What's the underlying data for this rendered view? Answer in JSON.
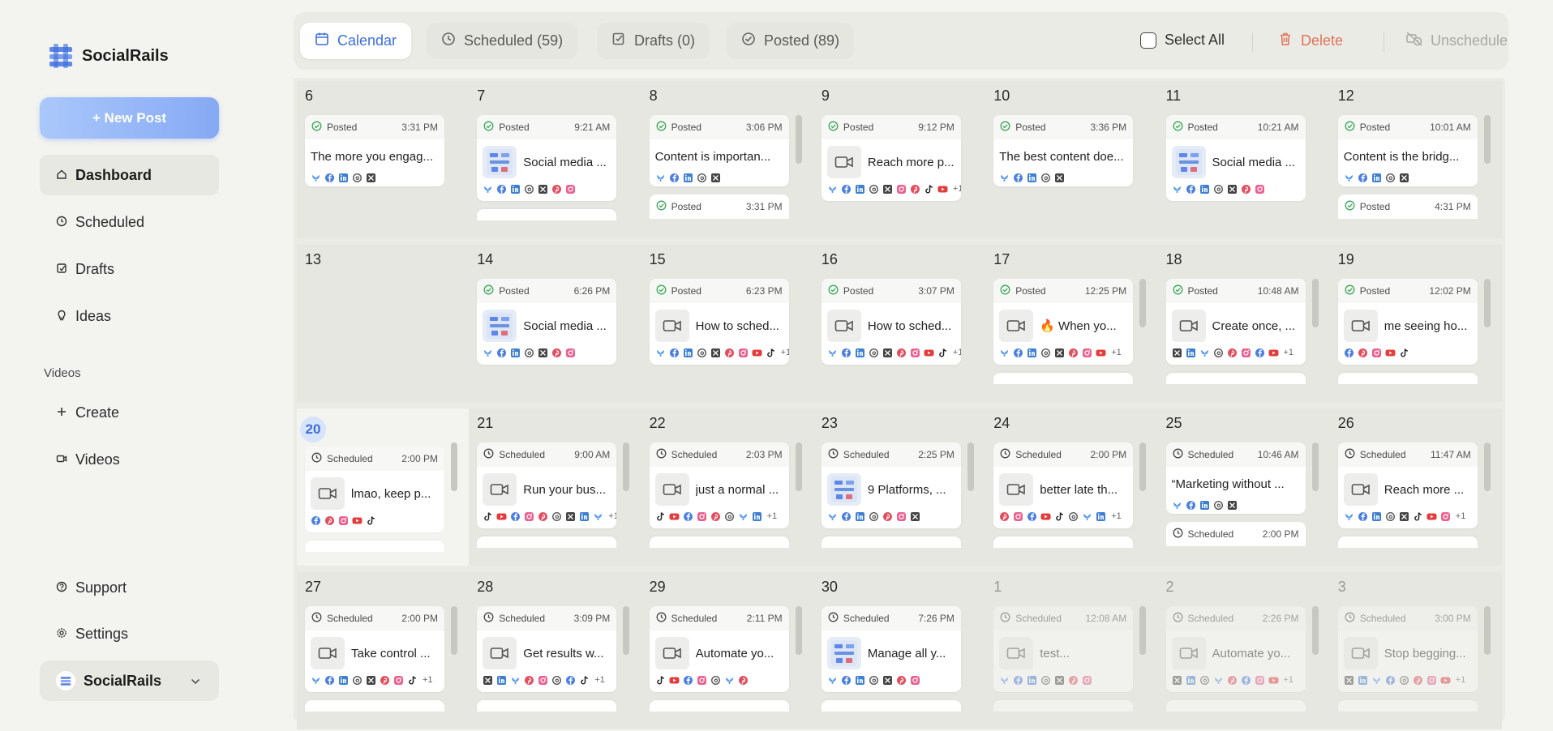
{
  "app": {
    "name": "SocialRails"
  },
  "sidebar": {
    "new_post": "+ New Post",
    "nav": [
      {
        "label": "Dashboard",
        "icon": "home-icon"
      },
      {
        "label": "Scheduled",
        "icon": "clock-icon"
      },
      {
        "label": "Drafts",
        "icon": "drafts-icon"
      },
      {
        "label": "Ideas",
        "icon": "lightbulb-icon"
      }
    ],
    "videos_section": "Videos",
    "videos_nav": [
      {
        "label": "Create",
        "icon": "plus-icon"
      },
      {
        "label": "Videos",
        "icon": "video-icon"
      }
    ],
    "bottom_nav": [
      {
        "label": "Support",
        "icon": "help-icon"
      },
      {
        "label": "Settings",
        "icon": "gear-icon"
      }
    ],
    "account": "SocialRails"
  },
  "toolbar": {
    "tabs": [
      "Calendar",
      "Scheduled (59)",
      "Drafts (0)",
      "Posted (89)"
    ],
    "select_all": "Select All",
    "delete": "Delete",
    "unschedule": "Unschedule"
  },
  "colors": {
    "accent": "#3c6fd8",
    "posted": "#3aa657",
    "delete": "#e0735a",
    "muted": "#a9a9a4"
  },
  "weeks": [
    {
      "days": [
        {
          "num": "6",
          "posts": [
            {
              "status": "Posted",
              "time": "3:31 PM",
              "text": "The more you engag...",
              "media": "none",
              "icons": [
                "bsky",
                "fb",
                "li",
                "th",
                "x"
              ]
            }
          ]
        },
        {
          "num": "7",
          "posts": [
            {
              "status": "Posted",
              "time": "9:21 AM",
              "text": "Social media ...",
              "media": "image",
              "icons": [
                "bsky",
                "fb",
                "li",
                "th",
                "x",
                "pin",
                "ig"
              ]
            }
          ],
          "stub": "line"
        },
        {
          "num": "8",
          "posts": [
            {
              "status": "Posted",
              "time": "3:06 PM",
              "text": "Content is importan...",
              "media": "none",
              "icons": [
                "bsky",
                "fb",
                "li",
                "th",
                "x"
              ]
            }
          ],
          "stub": {
            "status": "Posted",
            "time": "3:31 PM"
          },
          "scroll": true
        },
        {
          "num": "9",
          "posts": [
            {
              "status": "Posted",
              "time": "9:12 PM",
              "text": "Reach more p...",
              "media": "video",
              "icons": [
                "bsky",
                "fb",
                "li",
                "th",
                "x",
                "ig",
                "pin",
                "tt",
                "yt"
              ],
              "more": "+1"
            }
          ]
        },
        {
          "num": "10",
          "posts": [
            {
              "status": "Posted",
              "time": "3:36 PM",
              "text": "The best content doe...",
              "media": "none",
              "icons": [
                "bsky",
                "fb",
                "li",
                "th",
                "x"
              ]
            }
          ]
        },
        {
          "num": "11",
          "posts": [
            {
              "status": "Posted",
              "time": "10:21 AM",
              "text": "Social media ...",
              "media": "image",
              "icons": [
                "bsky",
                "fb",
                "li",
                "th",
                "x",
                "pin",
                "ig"
              ]
            }
          ]
        },
        {
          "num": "12",
          "posts": [
            {
              "status": "Posted",
              "time": "10:01 AM",
              "text": "Content is the bridg...",
              "media": "none",
              "icons": [
                "bsky",
                "fb",
                "li",
                "th",
                "x"
              ]
            }
          ],
          "stub": {
            "status": "Posted",
            "time": "4:31 PM"
          },
          "scroll": true
        }
      ]
    },
    {
      "days": [
        {
          "num": "13",
          "posts": []
        },
        {
          "num": "14",
          "posts": [
            {
              "status": "Posted",
              "time": "6:26 PM",
              "text": "Social media ...",
              "media": "image",
              "icons": [
                "bsky",
                "fb",
                "li",
                "th",
                "x",
                "pin",
                "ig"
              ]
            }
          ]
        },
        {
          "num": "15",
          "posts": [
            {
              "status": "Posted",
              "time": "6:23 PM",
              "text": "How to sched...",
              "media": "video",
              "icons": [
                "bsky",
                "fb",
                "li",
                "th",
                "x",
                "pin",
                "ig",
                "yt",
                "tt"
              ],
              "more": "+1"
            }
          ]
        },
        {
          "num": "16",
          "posts": [
            {
              "status": "Posted",
              "time": "3:07 PM",
              "text": "How to sched...",
              "media": "video",
              "icons": [
                "bsky",
                "fb",
                "li",
                "th",
                "x",
                "pin",
                "ig",
                "yt",
                "tt"
              ],
              "more": "+1"
            }
          ]
        },
        {
          "num": "17",
          "posts": [
            {
              "status": "Posted",
              "time": "12:25 PM",
              "text": "🔥 When yo...",
              "media": "video",
              "icons": [
                "bsky",
                "fb",
                "li",
                "th",
                "x",
                "pin",
                "ig",
                "yt"
              ],
              "more": "+1"
            }
          ],
          "stub": "line",
          "scroll": true
        },
        {
          "num": "18",
          "posts": [
            {
              "status": "Posted",
              "time": "10:48 AM",
              "text": "Create once, ...",
              "media": "video",
              "icons": [
                "x",
                "li",
                "bsky",
                "th",
                "pin",
                "ig",
                "fb",
                "yt"
              ],
              "more": "+1"
            }
          ],
          "stub": "line",
          "scroll": true
        },
        {
          "num": "19",
          "posts": [
            {
              "status": "Posted",
              "time": "12:02 PM",
              "text": "me seeing ho...",
              "media": "video",
              "icons": [
                "fb",
                "pin",
                "ig",
                "yt",
                "tt"
              ]
            }
          ],
          "stub": "line",
          "scroll": true
        }
      ]
    },
    {
      "days": [
        {
          "num": "20",
          "today": true,
          "posts": [
            {
              "status": "Scheduled",
              "time": "2:00 PM",
              "text": "lmao, keep p...",
              "media": "video",
              "icons": [
                "fb",
                "pin",
                "ig",
                "yt",
                "tt"
              ]
            }
          ],
          "stub": "line",
          "scroll": true
        },
        {
          "num": "21",
          "posts": [
            {
              "status": "Scheduled",
              "time": "9:00 AM",
              "text": "Run your bus...",
              "media": "video",
              "icons": [
                "tt",
                "yt",
                "fb",
                "ig",
                "pin",
                "th",
                "x",
                "li",
                "bsky"
              ],
              "more": "+1"
            }
          ],
          "stub": "line",
          "scroll": true
        },
        {
          "num": "22",
          "posts": [
            {
              "status": "Scheduled",
              "time": "2:03 PM",
              "text": "just a normal ...",
              "media": "video",
              "icons": [
                "tt",
                "yt",
                "fb",
                "ig",
                "pin",
                "th",
                "bsky",
                "li"
              ],
              "more": "+1"
            }
          ],
          "stub": "line",
          "scroll": true
        },
        {
          "num": "23",
          "posts": [
            {
              "status": "Scheduled",
              "time": "2:25 PM",
              "text": "9 Platforms, ...",
              "media": "image",
              "icons": [
                "bsky",
                "fb",
                "li",
                "th",
                "pin",
                "ig",
                "x"
              ]
            }
          ],
          "stub": "line",
          "scroll": true
        },
        {
          "num": "24",
          "posts": [
            {
              "status": "Scheduled",
              "time": "2:00 PM",
              "text": "better late th...",
              "media": "video",
              "icons": [
                "pin",
                "ig",
                "fb",
                "yt",
                "tt",
                "th",
                "bsky",
                "li"
              ],
              "more": "+1"
            }
          ],
          "stub": "line",
          "scroll": true
        },
        {
          "num": "25",
          "posts": [
            {
              "status": "Scheduled",
              "time": "10:46 AM",
              "text": "“Marketing without ...",
              "media": "none",
              "icons": [
                "bsky",
                "fb",
                "li",
                "th",
                "x"
              ]
            }
          ],
          "stub": {
            "status": "Scheduled",
            "time": "2:00 PM"
          },
          "scroll": true
        },
        {
          "num": "26",
          "posts": [
            {
              "status": "Scheduled",
              "time": "11:47 AM",
              "text": "Reach more ...",
              "media": "video",
              "icons": [
                "bsky",
                "fb",
                "li",
                "th",
                "x",
                "tt",
                "yt",
                "ig"
              ],
              "more": "+1"
            }
          ],
          "stub": "line",
          "scroll": true
        }
      ]
    },
    {
      "days": [
        {
          "num": "27",
          "posts": [
            {
              "status": "Scheduled",
              "time": "2:00 PM",
              "text": "Take control ...",
              "media": "video",
              "icons": [
                "bsky",
                "fb",
                "li",
                "th",
                "x",
                "pin",
                "ig",
                "tt"
              ],
              "more": "+1"
            }
          ],
          "stub": "line",
          "scroll": true
        },
        {
          "num": "28",
          "posts": [
            {
              "status": "Scheduled",
              "time": "3:09 PM",
              "text": "Get results w...",
              "media": "video",
              "icons": [
                "x",
                "li",
                "bsky",
                "pin",
                "ig",
                "th",
                "fb",
                "tt"
              ],
              "more": "+1"
            }
          ],
          "stub": "line",
          "scroll": true
        },
        {
          "num": "29",
          "posts": [
            {
              "status": "Scheduled",
              "time": "2:11 PM",
              "text": "Automate yo...",
              "media": "video",
              "icons": [
                "tt",
                "yt",
                "fb",
                "ig",
                "th",
                "bsky",
                "pin"
              ]
            }
          ],
          "stub": "line",
          "scroll": true
        },
        {
          "num": "30",
          "posts": [
            {
              "status": "Scheduled",
              "time": "7:26 PM",
              "text": "Manage all y...",
              "media": "image",
              "icons": [
                "bsky",
                "fb",
                "li",
                "th",
                "x",
                "pin",
                "ig"
              ]
            }
          ],
          "stub": "line"
        },
        {
          "num": "1",
          "muted": true,
          "posts": [
            {
              "status": "Scheduled",
              "time": "12:08 AM",
              "text": "test...",
              "media": "video",
              "icons": [
                "bsky",
                "fb",
                "li",
                "th",
                "x",
                "pin",
                "ig"
              ]
            }
          ],
          "stub": "line",
          "scroll": true
        },
        {
          "num": "2",
          "muted": true,
          "posts": [
            {
              "status": "Scheduled",
              "time": "2:26 PM",
              "text": "Automate yo...",
              "media": "video",
              "icons": [
                "x",
                "li",
                "th",
                "bsky",
                "pin",
                "fb",
                "ig",
                "yt"
              ],
              "more": "+1"
            }
          ],
          "stub": "line",
          "scroll": true
        },
        {
          "num": "3",
          "muted": true,
          "posts": [
            {
              "status": "Scheduled",
              "time": "3:00 PM",
              "text": "Stop begging...",
              "media": "video",
              "icons": [
                "x",
                "li",
                "bsky",
                "fb",
                "th",
                "pin",
                "ig",
                "yt"
              ],
              "more": "+1"
            }
          ],
          "stub": "line",
          "scroll": true
        }
      ]
    }
  ]
}
